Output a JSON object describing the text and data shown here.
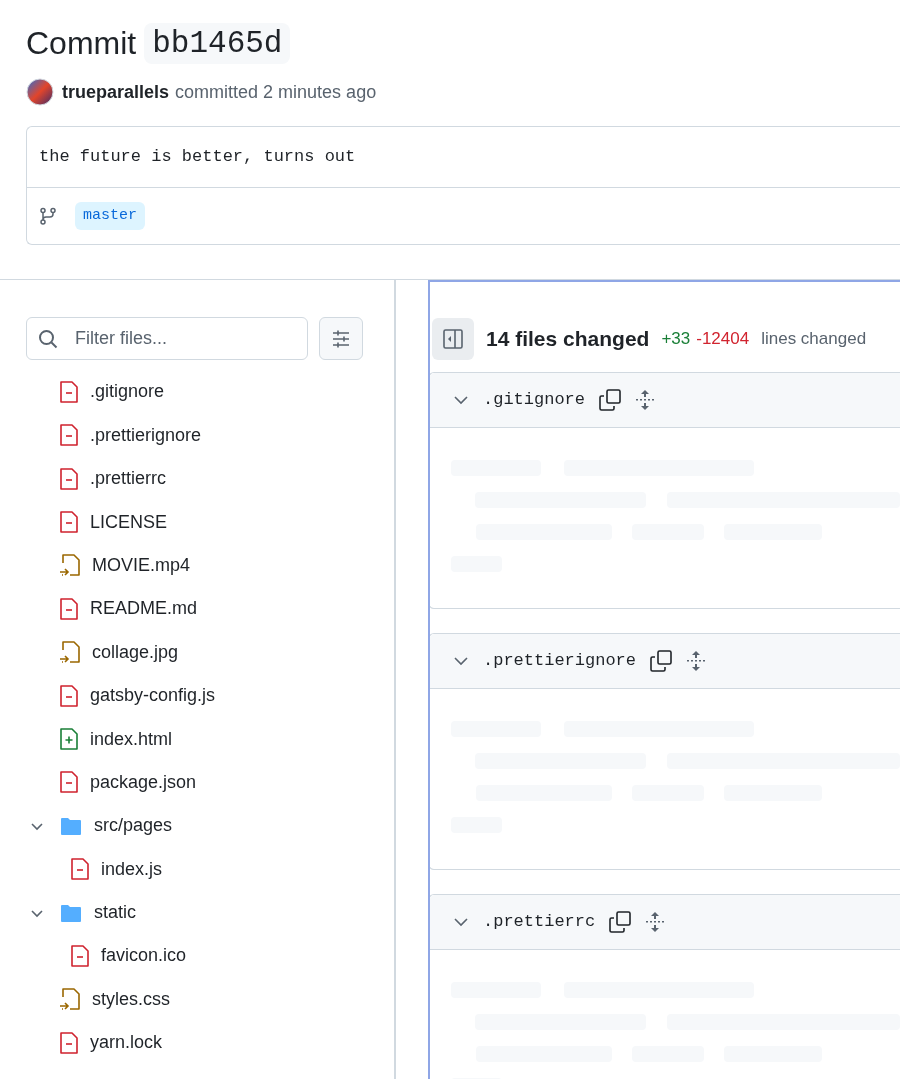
{
  "commit": {
    "label": "Commit",
    "sha": "bb1465d",
    "author": "trueparallels",
    "action": "committed 2 minutes ago",
    "message": "the future is better, turns out",
    "branch": "master"
  },
  "filter": {
    "placeholder": "Filter files..."
  },
  "tree": [
    {
      "kind": "removed",
      "name": ".gitignore"
    },
    {
      "kind": "removed",
      "name": ".prettierignore"
    },
    {
      "kind": "removed",
      "name": ".prettierrc"
    },
    {
      "kind": "removed",
      "name": "LICENSE"
    },
    {
      "kind": "renamed",
      "name": "MOVIE.mp4"
    },
    {
      "kind": "removed",
      "name": "README.md"
    },
    {
      "kind": "renamed",
      "name": "collage.jpg"
    },
    {
      "kind": "removed",
      "name": "gatsby-config.js"
    },
    {
      "kind": "added",
      "name": "index.html"
    },
    {
      "kind": "removed",
      "name": "package.json"
    },
    {
      "kind": "folder",
      "name": "src/pages",
      "expanded": true,
      "children": [
        {
          "kind": "removed",
          "name": "index.js"
        }
      ]
    },
    {
      "kind": "folder",
      "name": "static",
      "expanded": true,
      "children": [
        {
          "kind": "removed",
          "name": "favicon.ico"
        }
      ]
    },
    {
      "kind": "renamed",
      "name": "styles.css"
    },
    {
      "kind": "removed",
      "name": "yarn.lock"
    }
  ],
  "summary": {
    "files": "14 files changed",
    "additions": "+33",
    "deletions": "-12404",
    "suffix": "lines changed"
  },
  "diffs": [
    {
      "file": ".gitignore",
      "expanded": true
    },
    {
      "file": ".prettierignore",
      "expanded": true
    },
    {
      "file": ".prettierrc",
      "expanded": true
    }
  ]
}
